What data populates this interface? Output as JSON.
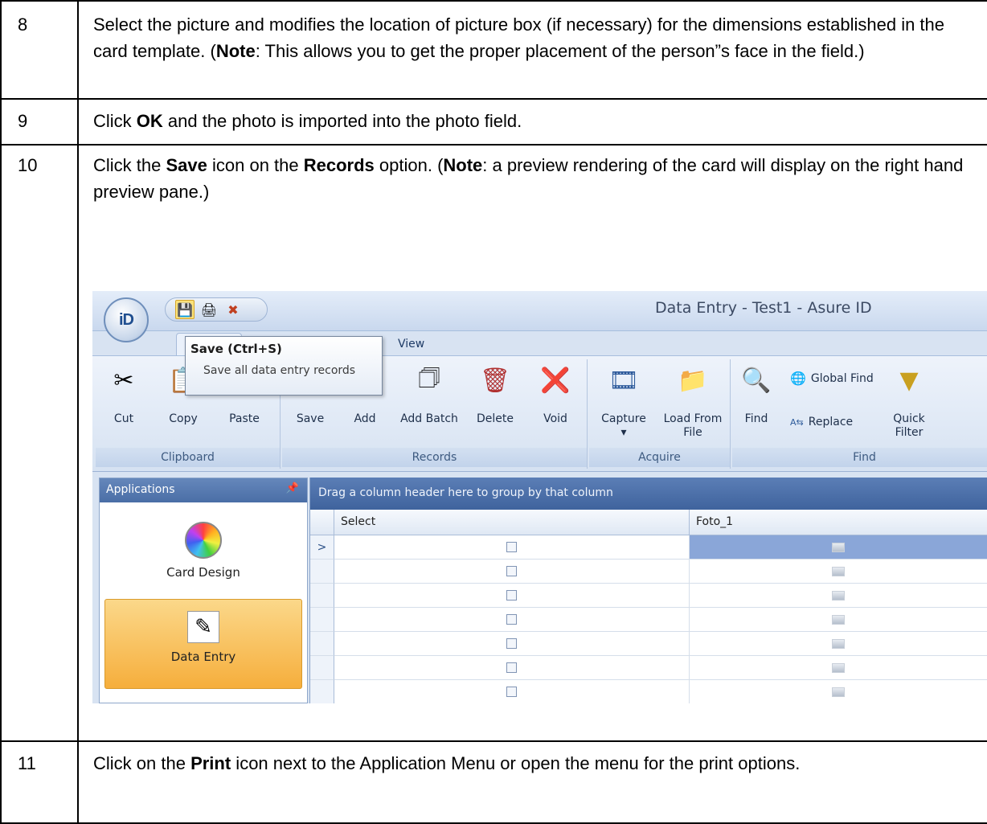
{
  "steps": [
    {
      "num": "8",
      "segments": [
        {
          "t": "Select the picture and modifies the location of picture box (if necessary) for the dimensions established in the card template. (",
          "b": false
        },
        {
          "t": "Note",
          "b": true
        },
        {
          "t": ":  This allows you to get the proper placement of the person”s face in the field.)",
          "b": false
        }
      ]
    },
    {
      "num": "9",
      "segments": [
        {
          "t": "Click ",
          "b": false
        },
        {
          "t": "OK",
          "b": true
        },
        {
          "t": " and the photo is imported into the photo field.",
          "b": false
        }
      ]
    },
    {
      "num": "10",
      "segments": [
        {
          "t": "Click the ",
          "b": false
        },
        {
          "t": "Save",
          "b": true
        },
        {
          "t": " icon on the ",
          "b": false
        },
        {
          "t": "Records",
          "b": true
        },
        {
          "t": " option. (",
          "b": false
        },
        {
          "t": "Note",
          "b": true
        },
        {
          "t": ":  a preview rendering of the card will display on the right hand preview pane.)",
          "b": false
        }
      ]
    },
    {
      "num": "11",
      "segments": [
        {
          "t": "Click on the ",
          "b": false
        },
        {
          "t": "Print",
          "b": true
        },
        {
          "t": " icon next to the Application Menu or open the menu for the print options.",
          "b": false
        }
      ]
    }
  ],
  "screenshot": {
    "window_title": "Data Entry - Test1 - Asure ID",
    "logo_text": "iD",
    "tab_view": "View",
    "tooltip": {
      "title": "Save (Ctrl+S)",
      "description": "Save all data entry records"
    },
    "ribbon": {
      "clipboard": {
        "label": "Clipboard",
        "cut": "Cut",
        "copy": "Copy",
        "paste": "Paste"
      },
      "records": {
        "label": "Records",
        "save": "Save",
        "add": "Add",
        "add_batch": "Add Batch",
        "delete": "Delete",
        "void": "Void"
      },
      "acquire": {
        "label": "Acquire",
        "capture": "Capture",
        "load_from_file": "Load From File"
      },
      "find": {
        "label": "Find",
        "find": "Find",
        "global_find": "Global Find",
        "replace": "Replace",
        "quick_filter": "Quick Filter"
      }
    },
    "applications": {
      "header": "Applications",
      "items": [
        "Card Design",
        "Data Entry"
      ]
    },
    "grid": {
      "group_hint": "Drag a column header here to group by that column",
      "columns": [
        "Select",
        "Foto_1"
      ],
      "row_indicator": ">"
    },
    "icons": [
      "app-orb-icon",
      "save-icon",
      "print-icon",
      "undo-icon",
      "cut-icon",
      "copy-icon",
      "paste-icon",
      "save-record-icon",
      "add-icon",
      "add-batch-icon",
      "delete-icon",
      "void-icon",
      "capture-icon",
      "folder-icon",
      "binoculars-icon",
      "globe-icon",
      "replace-icon",
      "filter-icon",
      "color-wheel-icon",
      "notepad-icon",
      "pin-icon",
      "checkbox-icon",
      "picture-icon"
    ]
  }
}
